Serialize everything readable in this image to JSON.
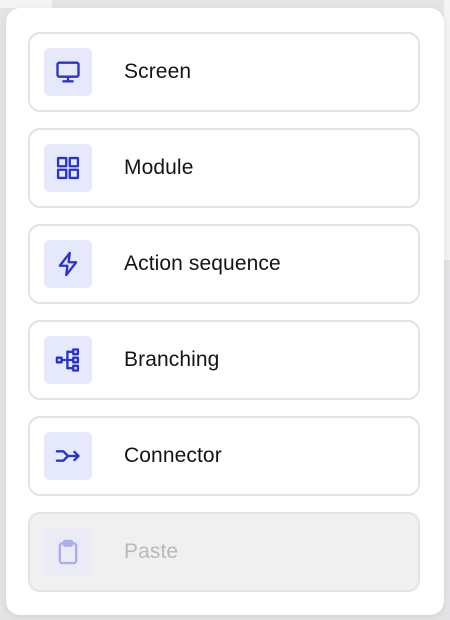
{
  "menu": {
    "items": [
      {
        "label": "Screen",
        "icon": "monitor-icon",
        "disabled": false
      },
      {
        "label": "Module",
        "icon": "grid-icon",
        "disabled": false
      },
      {
        "label": "Action sequence",
        "icon": "lightning-icon",
        "disabled": false
      },
      {
        "label": "Branching",
        "icon": "branching-icon",
        "disabled": false
      },
      {
        "label": "Connector",
        "icon": "connector-arrow-icon",
        "disabled": false
      },
      {
        "label": "Paste",
        "icon": "clipboard-icon",
        "disabled": true
      }
    ]
  },
  "colors": {
    "accent": "#2b34c8",
    "icon_tile_bg": "#e6e8fb",
    "border": "#e2e2e4",
    "disabled_text": "#b9b9bc",
    "disabled_bg": "#f0f0f1"
  }
}
